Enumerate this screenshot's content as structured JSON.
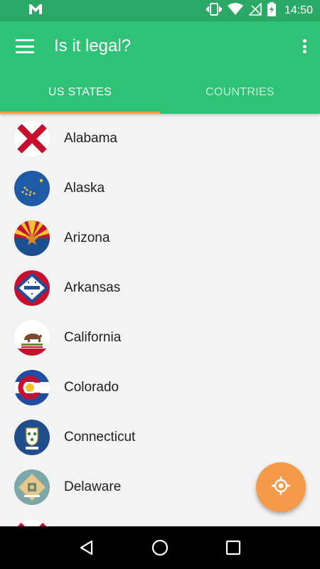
{
  "status_bar": {
    "time": "14:50",
    "bg_color": "#2aa865"
  },
  "app_bar": {
    "title": "Is it legal?",
    "bg_color": "#2ec276"
  },
  "tabs": [
    {
      "label": "US STATES",
      "active": true
    },
    {
      "label": "COUNTRIES",
      "active": false
    }
  ],
  "tab_indicator_color": "#f0a14a",
  "states": [
    {
      "name": "Alabama",
      "flag": "alabama-flag-icon"
    },
    {
      "name": "Alaska",
      "flag": "alaska-flag-icon"
    },
    {
      "name": "Arizona",
      "flag": "arizona-flag-icon"
    },
    {
      "name": "Arkansas",
      "flag": "arkansas-flag-icon"
    },
    {
      "name": "California",
      "flag": "california-flag-icon"
    },
    {
      "name": "Colorado",
      "flag": "colorado-flag-icon"
    },
    {
      "name": "Connecticut",
      "flag": "connecticut-flag-icon"
    },
    {
      "name": "Delaware",
      "flag": "delaware-flag-icon"
    }
  ],
  "fab": {
    "icon": "my-location-icon",
    "color": "#f59a48"
  }
}
